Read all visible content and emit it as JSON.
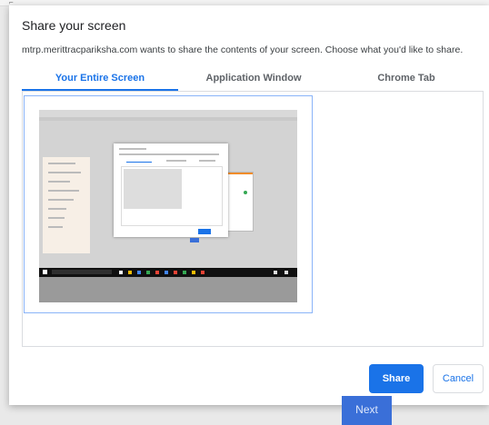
{
  "background_page": {
    "next_button": "Next"
  },
  "dialog": {
    "title": "Share your screen",
    "subtitle": "mtrp.merittracpariksha.com wants to share the contents of your screen. Choose what you'd like to share.",
    "tabs": [
      {
        "label": "Your Entire Screen",
        "active": true
      },
      {
        "label": "Application Window",
        "active": false
      },
      {
        "label": "Chrome Tab",
        "active": false
      }
    ],
    "screen_thumbnail_selected": true,
    "buttons": {
      "share": "Share",
      "cancel": "Cancel"
    }
  },
  "colors": {
    "accent": "#1a73e8",
    "thumbnail_border": "#8ab4f8",
    "background_next": "#3a6fd8"
  }
}
